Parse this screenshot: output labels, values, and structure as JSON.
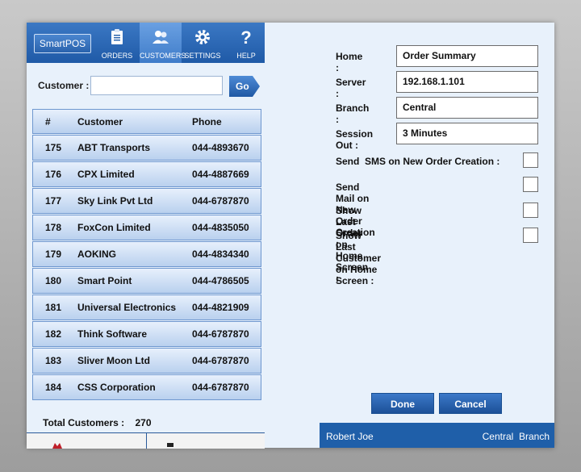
{
  "app": {
    "logo": "SmartPOS",
    "nav": [
      {
        "label": "ORDERS",
        "icon": "clipboard-icon",
        "active": false
      },
      {
        "label": "CUSTOMERS",
        "icon": "users-icon",
        "active": true
      },
      {
        "label": "SETTINGS",
        "icon": "gear-icon",
        "active": false
      },
      {
        "label": "HELP",
        "icon": "question-icon",
        "active": false
      }
    ]
  },
  "search": {
    "label": "Customer :",
    "value": "",
    "placeholder": "",
    "go_label": "Go"
  },
  "table": {
    "headers": [
      "#",
      "Customer",
      "Phone"
    ],
    "rows": [
      {
        "id": "175",
        "name": "ABT Transports",
        "phone": "044-4893670"
      },
      {
        "id": "176",
        "name": "CPX Limited",
        "phone": "044-4887669"
      },
      {
        "id": "177",
        "name": "Sky Link Pvt Ltd",
        "phone": "044-6787870"
      },
      {
        "id": "178",
        "name": "FoxCon Limited",
        "phone": "044-4835050"
      },
      {
        "id": "179",
        "name": "AOKING",
        "phone": "044-4834340"
      },
      {
        "id": "180",
        "name": "Smart Point",
        "phone": "044-4786505"
      },
      {
        "id": "181",
        "name": "Universal Electronics",
        "phone": "044-4821909"
      },
      {
        "id": "182",
        "name": "Think Software",
        "phone": "044-6787870"
      },
      {
        "id": "183",
        "name": "Sliver Moon Ltd",
        "phone": "044-6787870"
      },
      {
        "id": "184",
        "name": "CSS Corporation",
        "phone": "044-6787870"
      }
    ]
  },
  "total": {
    "label": "Total Customers :",
    "value": "270"
  },
  "settings": {
    "fields": [
      {
        "label": "Home :",
        "value": "Order Summary"
      },
      {
        "label": "Server :",
        "value": "192.168.1.101"
      },
      {
        "label": "Branch :",
        "value": "Central"
      },
      {
        "label": "Session Out :",
        "value": "3 Minutes"
      }
    ],
    "checks": [
      {
        "label": "Send  SMS on New Order Creation :",
        "checked": false
      },
      {
        "label": "Send Mail on New Order Creation :",
        "checked": false
      },
      {
        "label": "Show Last Order on Home Screen :",
        "checked": false
      },
      {
        "label": "Show Last Customer on Home Screen :",
        "checked": false
      }
    ],
    "done_label": "Done",
    "cancel_label": "Cancel"
  },
  "status": {
    "user": "Robert Joe",
    "branch": "Central  Branch"
  },
  "colors": {
    "accent": "#1f5fa9",
    "row_bg": "#cfe0f5",
    "pane_bg": "#e8f1fb"
  }
}
